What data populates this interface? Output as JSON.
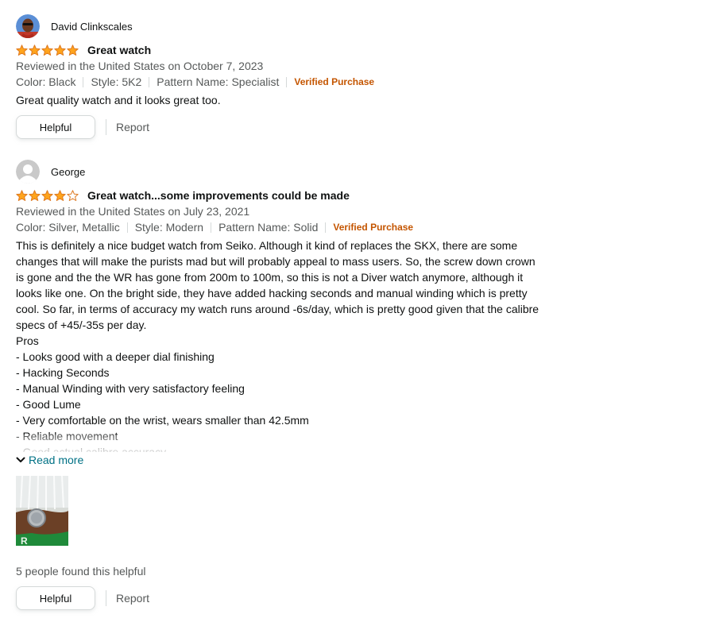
{
  "reviews": [
    {
      "profile_name": "David Clinkscales",
      "rating": 5,
      "title": "Great watch",
      "reviewed_in": "Reviewed in the United States on October 7, 2023",
      "variants": [
        "Color: Black",
        "Style: 5K2",
        "Pattern Name: Specialist"
      ],
      "verified": "Verified Purchase",
      "body": "Great quality watch and it looks great too.",
      "helpful_button": "Helpful",
      "report": "Report"
    },
    {
      "profile_name": "George",
      "rating": 4,
      "title": "Great watch...some improvements could be made",
      "reviewed_in": "Reviewed in the United States on July 23, 2021",
      "variants": [
        "Color: Silver, Metallic",
        "Style: Modern",
        "Pattern Name: Solid"
      ],
      "verified": "Verified Purchase",
      "body_lines": [
        "This is definitely a nice budget watch from Seiko. Although it kind of replaces the SKX, there are some",
        "changes that will make the purists mad but will probably appeal to mass users. So, the screw down crown",
        "is gone and the the WR has gone from 200m to 100m, so this is not a Diver watch anymore, although it",
        "looks like one. On the bright side, they have added hacking seconds and manual winding which is pretty",
        "cool. So far, in terms of accuracy my watch runs around -6s/day, which is pretty good given that the calibre",
        "specs of +45/-35s per day.",
        "Pros",
        "- Looks good with a deeper dial finishing",
        "- Hacking Seconds",
        "- Manual Winding with very satisfactory feeling",
        "- Good Lume",
        "- Very comfortable on the wrist, wears smaller than 42.5mm",
        "- Reliable movement",
        "- Good actual calibre accuracy"
      ],
      "read_more": "Read more",
      "helpful_count": "5 people found this helpful",
      "helpful_button": "Helpful",
      "report": "Report"
    }
  ],
  "colors": {
    "star_fill": "#ffa41c",
    "star_outline": "#de7921",
    "verified": "#c45500",
    "link": "#007185",
    "secondary_text": "#565959"
  },
  "icons": {
    "star_full": "star-full-icon",
    "star_empty": "star-empty-icon",
    "chevron": "chevron-down-icon"
  }
}
